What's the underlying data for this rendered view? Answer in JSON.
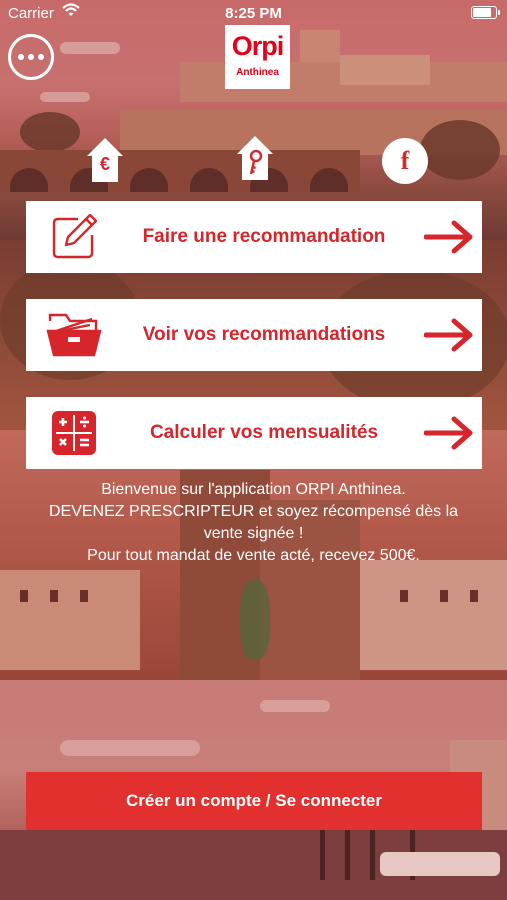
{
  "status_bar": {
    "carrier": "Carrier",
    "time": "8:25 PM",
    "battery_level": 0.9
  },
  "header": {
    "logo_brand": "Orpi",
    "logo_agency": "Anthinea",
    "house_left_glyph": "€",
    "facebook_glyph": "f"
  },
  "actions": [
    {
      "label": "Faire une recommandation",
      "icon": "edit-icon"
    },
    {
      "label": "Voir vos recommandations",
      "icon": "folder-icon"
    },
    {
      "label": "Calculer vos mensualités",
      "icon": "calculator-icon"
    }
  ],
  "welcome": {
    "line1": "Bienvenue sur l'application ORPI Anthinea.",
    "line2": "DEVENEZ PRESCRIPTEUR et soyez récompensé dès la vente signée !",
    "line3": "Pour tout mandat de vente acté, recevez 500€."
  },
  "cta": {
    "label": "Créer un compte / Se connecter"
  },
  "colors": {
    "brand_red": "#d6262c",
    "cta_red": "#e2302f",
    "white": "#ffffff"
  }
}
